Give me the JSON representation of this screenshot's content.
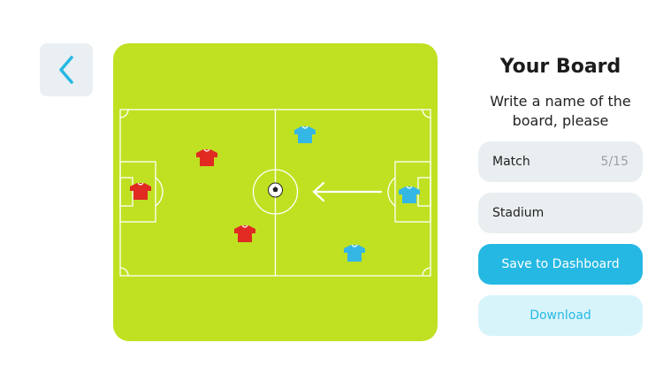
{
  "panel": {
    "title": "Your Board",
    "subtitle": "Write a name of the\nboard, please",
    "match_field": {
      "value": "Match",
      "char_count": "5/15"
    },
    "stadium_field": {
      "value": "Stadium"
    },
    "save_button_label": "Save to Dashboard",
    "download_button_label": "Download"
  },
  "colors": {
    "pitch": "#bfe122",
    "team_red": "#e02a22",
    "team_blue": "#35b7e6",
    "accent": "#25b8e3"
  },
  "icons": {
    "back": "chevron-left-icon",
    "ball": "soccer-ball-icon",
    "arrow": "arrow-left-icon",
    "player": "jersey-icon"
  }
}
